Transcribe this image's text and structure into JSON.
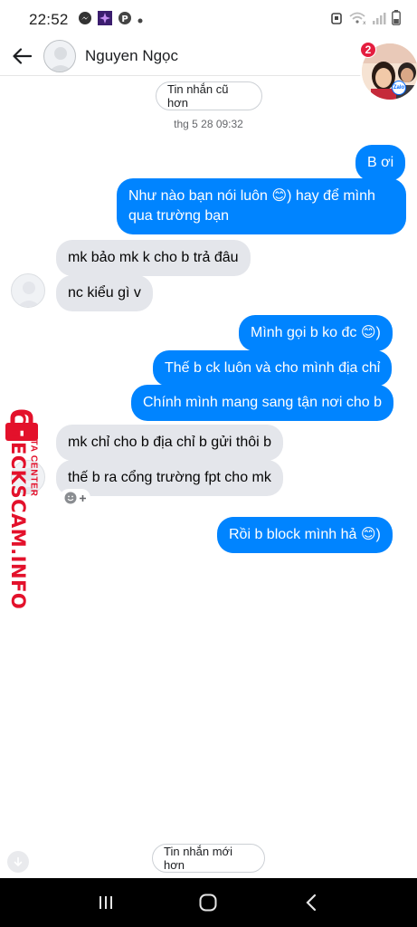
{
  "status_bar": {
    "time": "22:52"
  },
  "header": {
    "contact_name": "Nguyen Ngọc"
  },
  "chat_head": {
    "badge_count": "2",
    "badge_app": "Zalo"
  },
  "pills": {
    "older": "Tin nhắn cũ hơn",
    "newer": "Tin nhắn mới hơn"
  },
  "timestamp": "thg 5 28 09:32",
  "messages": [
    {
      "side": "out",
      "text": "B ơi"
    },
    {
      "side": "out",
      "text": "Như nào bạn nói luôn 😊) hay để mình qua trường bạn"
    },
    {
      "side": "in",
      "text": "mk bảo mk k cho b trả đâu"
    },
    {
      "side": "in",
      "text": "nc kiểu gì v"
    },
    {
      "side": "out",
      "text": "Mình gọi b ko đc 😊)"
    },
    {
      "side": "out",
      "text": "Thế b ck luôn và cho mình địa chỉ"
    },
    {
      "side": "out",
      "text": "Chính mình mang sang tận nơi cho b"
    },
    {
      "side": "in",
      "text": "mk chỉ cho b địa chỉ b gửi thôi b"
    },
    {
      "side": "in",
      "text": "thế b ra cổng trường fpt cho mk"
    },
    {
      "side": "out",
      "text": "Rồi b block mình hả 😊)"
    }
  ],
  "watermark": {
    "main": "CHECKSCAM.INFO",
    "sub": "DATA CENTER"
  },
  "colors": {
    "outgoing": "#0084ff",
    "incoming": "#e4e6eb",
    "watermark": "#e3112b"
  }
}
